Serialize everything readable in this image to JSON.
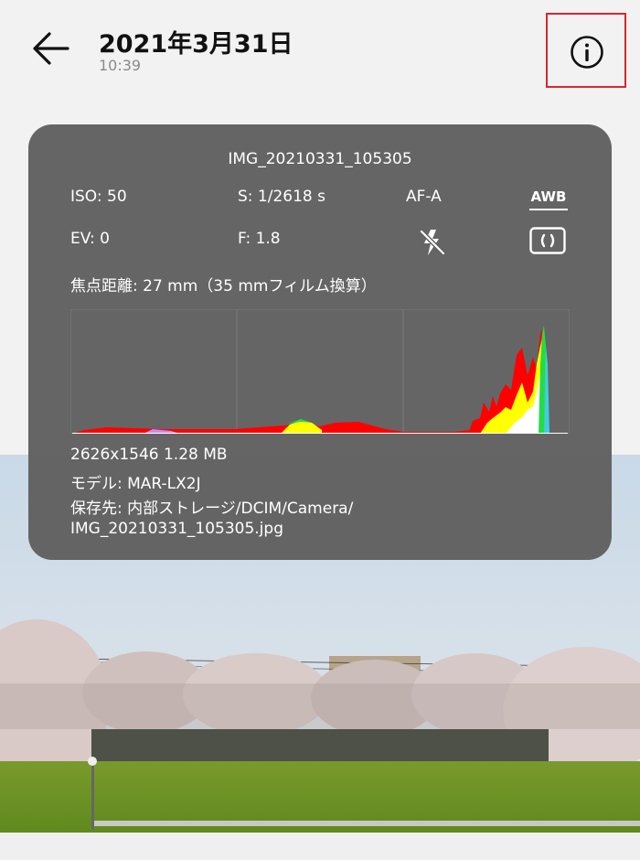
{
  "header": {
    "title": "2021年3月31日",
    "time": "10:39"
  },
  "info": {
    "filename": "IMG_20210331_105305",
    "iso": "ISO: 50",
    "shutter": "S: 1/2618 s",
    "focus_mode": "AF-A",
    "white_balance": "AWB",
    "ev": "EV: 0",
    "aperture": "F: 1.8",
    "focal_length": "焦点距離: 27 mm（35 mmフィルム換算）",
    "resolution_size": "2626x1546  1.28 MB",
    "model": "モデル:  MAR-LX2J",
    "path_line1": "保存先:  内部ストレージ/DCIM/Camera/",
    "path_line2": "IMG_20210331_105305.jpg"
  },
  "icons": {
    "back": "arrow-left-icon",
    "info": "info-circle-icon",
    "flash": "flash-off-icon",
    "metering": "metering-mode-icon"
  },
  "colors": {
    "card_bg": "#606060",
    "highlight_border": "#d9262c",
    "histogram_red": "#ff0000",
    "histogram_yellow": "#ffff00",
    "histogram_green": "#22dd44",
    "histogram_white": "#ffffff"
  }
}
